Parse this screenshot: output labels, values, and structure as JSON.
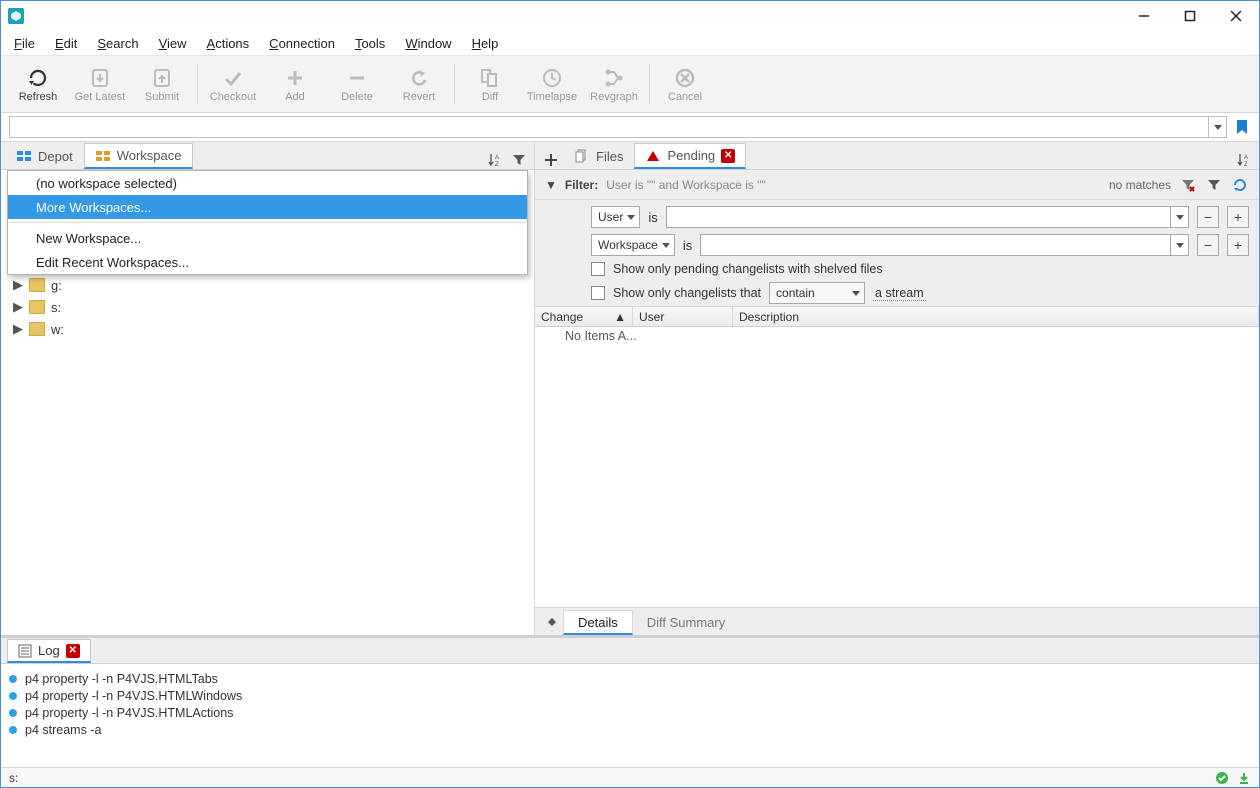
{
  "menubar": [
    "File",
    "Edit",
    "Search",
    "View",
    "Actions",
    "Connection",
    "Tools",
    "Window",
    "Help"
  ],
  "toolbar": [
    {
      "label": "Refresh",
      "enabled": true
    },
    {
      "label": "Get Latest",
      "enabled": false
    },
    {
      "label": "Submit",
      "enabled": false
    },
    {
      "sep": true
    },
    {
      "label": "Checkout",
      "enabled": false
    },
    {
      "label": "Add",
      "enabled": false
    },
    {
      "label": "Delete",
      "enabled": false
    },
    {
      "label": "Revert",
      "enabled": false
    },
    {
      "sep": true
    },
    {
      "label": "Diff",
      "enabled": false
    },
    {
      "label": "Timelapse",
      "enabled": false
    },
    {
      "label": "Revgraph",
      "enabled": false
    },
    {
      "sep": true
    },
    {
      "label": "Cancel",
      "enabled": false
    }
  ],
  "left_tabs": {
    "depot": "Depot",
    "workspace": "Workspace"
  },
  "workspace_dropdown": {
    "none": "(no workspace selected)",
    "more": "More Workspaces...",
    "new": "New Workspace...",
    "edit": "Edit Recent Workspaces..."
  },
  "tree_items": [
    "g:",
    "s:",
    "w:"
  ],
  "right_tabs": {
    "files": "Files",
    "pending": "Pending"
  },
  "filter": {
    "label": "Filter:",
    "summary": "User is \"\" and Workspace is \"\"",
    "no_matches": "no matches",
    "user": "User",
    "workspace": "Workspace",
    "is": "is",
    "shelved": "Show only pending changelists with shelved files",
    "stream_prefix": "Show only changelists that",
    "contain": "contain",
    "stream_suffix": "a stream"
  },
  "grid": {
    "cols": [
      "Change",
      "User",
      "Description"
    ],
    "empty": "No Items A..."
  },
  "detail_tabs": {
    "details": "Details",
    "diff": "Diff Summary"
  },
  "log": {
    "title": "Log",
    "lines": [
      "p4 property -l -n P4VJS.HTMLTabs",
      "p4 property -l -n P4VJS.HTMLWindows",
      "p4 property -l -n P4VJS.HTMLActions",
      "p4 streams -a"
    ]
  },
  "statusbar": {
    "left": "s:"
  }
}
